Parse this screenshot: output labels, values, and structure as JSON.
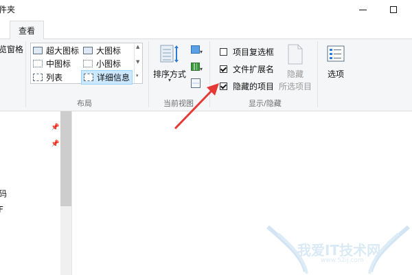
{
  "window": {
    "title": "件夹",
    "minimize_icon": "minimize-icon",
    "maximize_icon": "maximize-icon"
  },
  "ribbon": {
    "active_tab": "查看",
    "pane": {
      "fragment_label": "览窗格"
    },
    "layout": {
      "items": [
        {
          "label": "超大图标",
          "icon": "extra-large-icons-icon"
        },
        {
          "label": "大图标",
          "icon": "large-icons-icon"
        },
        {
          "label": "中图标",
          "icon": "medium-icons-icon"
        },
        {
          "label": "小图标",
          "icon": "small-icons-icon"
        },
        {
          "label": "列表",
          "icon": "list-icon"
        },
        {
          "label": "详细信息",
          "icon": "details-icon",
          "selected": true
        }
      ],
      "group_label": "布局"
    },
    "current_view": {
      "sort_label": "排序方式",
      "group_label": "当前视图"
    },
    "show_hide": {
      "item_checkboxes": {
        "label": "项目复选框",
        "checked": false
      },
      "file_extensions": {
        "label": "文件扩展名",
        "checked": true
      },
      "hidden_items": {
        "label": "隐藏的项目",
        "checked": true
      },
      "hide_selected": {
        "label_line1": "隐藏",
        "label_line2": "所选项目"
      },
      "group_label": "显示/隐藏"
    },
    "options": {
      "label": "选项"
    }
  },
  "nav": {
    "item1": "码",
    "item2": "F"
  },
  "annotation": {
    "arrow_color": "#e53935"
  },
  "watermark": {
    "text": "我爱IT技术网",
    "url": "www.52ij.com"
  }
}
